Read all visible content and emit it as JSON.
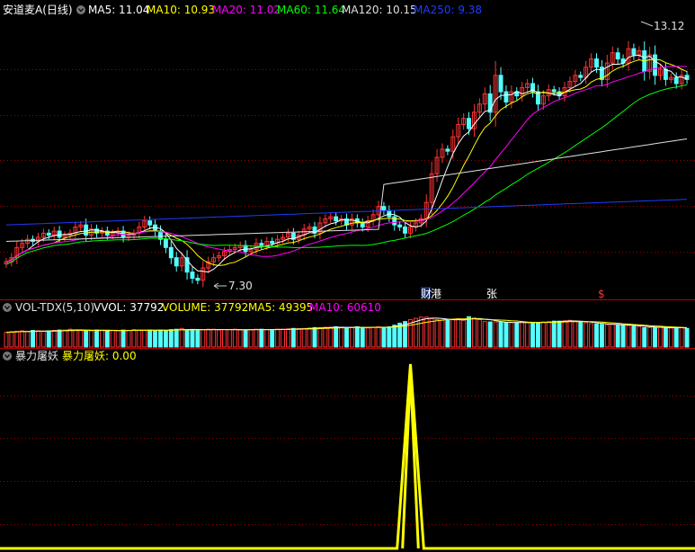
{
  "main": {
    "title": "安道麦A(日线)",
    "ma5_label": "MA5: 11.04",
    "ma10_label": "MA10: 10.93",
    "ma20_label": "MA20: 11.02",
    "ma60_label": "MA60: 11.64",
    "ma120_label": "MA120: 10.15",
    "ma250_label": "MA250: 9.38",
    "high_mark": "13.12",
    "low_mark": "7.30",
    "markers": [
      "财",
      "港",
      "张",
      "$"
    ]
  },
  "vol": {
    "title": "VOL-TDX(5,10)",
    "vvol_label": "VVOL: 37792",
    "volume_label": "VOLUME: 37792",
    "ma5_label": "MA5: 49395",
    "ma10_label": "MA10: 60610"
  },
  "ind": {
    "title": "暴力屠妖",
    "value_label": "暴力屠妖: 0.00"
  },
  "colors": {
    "up": "#ff3333",
    "down": "#54ffff",
    "ma5": "#ffffff",
    "ma10": "#ffff00",
    "ma20": "#ff00ff",
    "ma60": "#00ff00",
    "ma120": "#e0e0e0",
    "ma250": "#1e3cff",
    "indicator": "#ffff00",
    "grid": "#a00000"
  },
  "chart_data": {
    "type": "candlestick",
    "closes": [
      7.85,
      7.95,
      8.2,
      8.3,
      8.4,
      8.35,
      8.45,
      8.55,
      8.5,
      8.6,
      8.45,
      8.5,
      8.55,
      8.7,
      8.75,
      8.5,
      8.65,
      8.55,
      8.6,
      8.5,
      8.55,
      8.6,
      8.45,
      8.5,
      8.55,
      8.7,
      8.85,
      8.75,
      8.6,
      8.4,
      8.2,
      7.95,
      7.75,
      7.95,
      7.6,
      7.45,
      7.4,
      7.7,
      7.85,
      7.95,
      8.0,
      8.1,
      8.15,
      8.2,
      8.25,
      8.1,
      8.15,
      8.3,
      8.25,
      8.35,
      8.3,
      8.4,
      8.45,
      8.55,
      8.4,
      8.5,
      8.65,
      8.7,
      8.55,
      8.8,
      8.9,
      8.95,
      8.85,
      8.9,
      8.75,
      8.9,
      8.8,
      8.7,
      8.85,
      9.0,
      9.2,
      9.1,
      8.95,
      8.75,
      8.7,
      8.55,
      8.7,
      8.8,
      8.9,
      9.3,
      10.0,
      10.4,
      10.6,
      10.55,
      10.9,
      11.2,
      11.35,
      11.1,
      11.5,
      11.7,
      11.95,
      11.5,
      12.4,
      12.0,
      11.75,
      12.0,
      11.9,
      12.1,
      12.2,
      12.0,
      11.7,
      11.9,
      12.05,
      12.0,
      11.9,
      12.1,
      12.25,
      12.4,
      12.35,
      12.6,
      12.8,
      12.6,
      12.3,
      12.7,
      12.95,
      12.8,
      12.7,
      13.05,
      12.9,
      13.0,
      12.5,
      12.9,
      12.4,
      12.55,
      12.3,
      12.35,
      12.2,
      12.4,
      12.3
    ],
    "volumes": [
      36,
      38,
      39,
      40,
      38,
      41,
      40,
      39,
      40,
      41,
      42,
      42,
      44,
      42,
      41,
      41,
      40,
      42,
      41,
      40,
      41,
      40,
      42,
      41,
      43,
      42,
      41,
      42,
      41,
      42,
      41,
      43,
      44,
      46,
      42,
      43,
      42,
      43,
      44,
      44,
      42,
      43,
      43,
      44,
      42,
      42,
      43,
      44,
      44,
      43,
      43,
      44,
      44,
      45,
      46,
      45,
      46,
      47,
      48,
      48,
      49,
      49,
      50,
      48,
      47,
      49,
      50,
      48,
      47,
      49,
      50,
      49,
      50,
      54,
      59,
      63,
      68,
      71,
      74,
      74,
      70,
      68,
      66,
      66,
      68,
      70,
      66,
      75,
      72,
      68,
      63,
      62,
      62,
      61,
      61,
      60,
      60,
      61,
      60,
      61,
      60,
      62,
      63,
      64,
      64,
      65,
      66,
      63,
      62,
      60,
      58,
      57,
      56,
      55,
      56,
      55,
      54,
      53,
      52,
      51,
      48,
      48,
      48,
      49,
      48,
      47,
      47,
      48,
      46
    ],
    "ma_values": {
      "ma5": 11.04,
      "ma10": 10.93,
      "ma20": 11.02,
      "ma60": 11.64,
      "ma120": 10.15,
      "ma250": 9.38
    },
    "vol_values": {
      "vvol": 37792,
      "volume": 37792,
      "ma5": 49395,
      "ma10": 60610
    },
    "indicator_series": {
      "spike_index": 76,
      "spike_width": 5,
      "value": 0.0,
      "max": 1
    },
    "high": 13.12,
    "low": 7.3,
    "ylim": [
      7.0,
      13.8
    ],
    "grid": true
  }
}
